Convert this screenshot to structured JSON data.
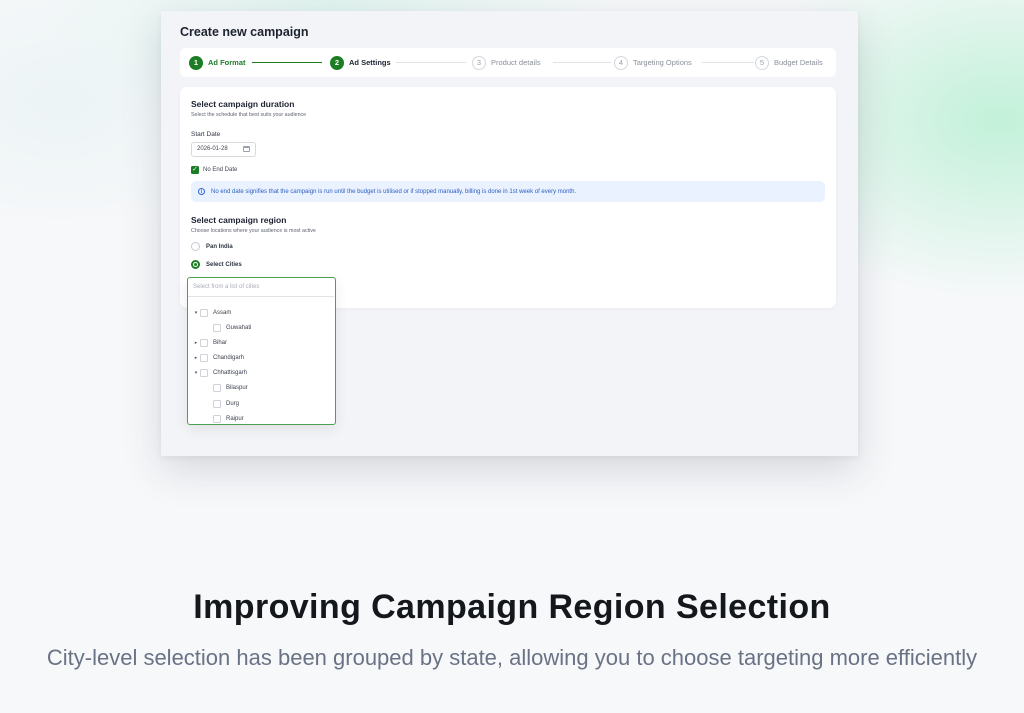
{
  "window": {
    "title": "Create new campaign"
  },
  "stepper": {
    "steps": [
      {
        "num": "1",
        "label": "Ad Format",
        "state": "done"
      },
      {
        "num": "2",
        "label": "Ad Settings",
        "state": "current"
      },
      {
        "num": "3",
        "label": "Product details",
        "state": "pending"
      },
      {
        "num": "4",
        "label": "Targeting Options",
        "state": "pending"
      },
      {
        "num": "5",
        "label": "Budget Details",
        "state": "pending"
      }
    ]
  },
  "duration": {
    "title": "Select campaign duration",
    "subtitle": "Select the schedule that best suits your audience",
    "start_label": "Start Date",
    "start_value": "2026-01-28",
    "no_end_label": "No End Date",
    "no_end_checked": true,
    "info": "No end date signifies that the campaign is run until the budget is utilised or if stopped manually, billing is done in 1st week of every month."
  },
  "region": {
    "title": "Select campaign region",
    "subtitle": "Choose locations where your audience is most active",
    "options": [
      {
        "label": "Pan India",
        "selected": false
      },
      {
        "label": "Select Cities",
        "selected": true
      }
    ],
    "search_placeholder": "Select from a list of cities",
    "tree": [
      {
        "label": "Assam",
        "level": 0,
        "caret": "▾"
      },
      {
        "label": "Guwahati",
        "level": 1,
        "caret": ""
      },
      {
        "label": "Bihar",
        "level": 0,
        "caret": "▸"
      },
      {
        "label": "Chandigarh",
        "level": 0,
        "caret": "▸"
      },
      {
        "label": "Chhattisgarh",
        "level": 0,
        "caret": "▾"
      },
      {
        "label": "Bilaspur",
        "level": 1,
        "caret": ""
      },
      {
        "label": "Durg",
        "level": 1,
        "caret": ""
      },
      {
        "label": "Raipur",
        "level": 1,
        "caret": ""
      }
    ]
  },
  "hero": {
    "headline": "Improving Campaign Region Selection",
    "subline": "City-level selection has been grouped by state, allowing you to choose targeting more efficiently"
  },
  "colors": {
    "accent_green": "#1d7d24",
    "info_blue": "#2c5fc0",
    "info_bg": "#eaf1ff"
  }
}
